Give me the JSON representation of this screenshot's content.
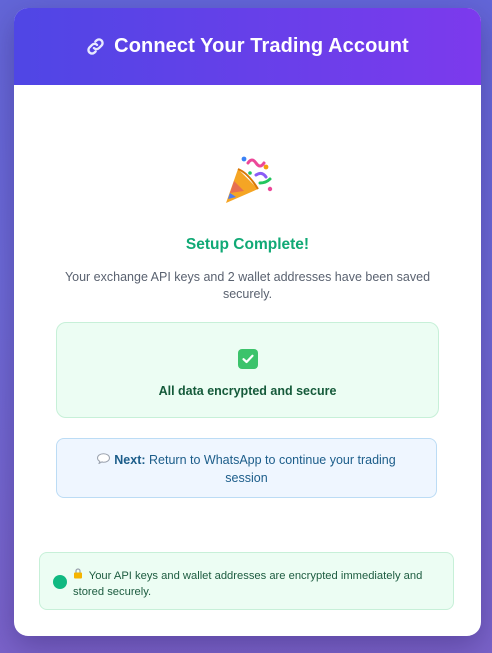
{
  "header": {
    "icon": "link-icon",
    "title": "Connect Your Trading Account"
  },
  "status": {
    "icon": "party-popper-icon",
    "title": "Setup Complete!",
    "description": "Your exchange API keys and 2 wallet addresses have been saved securely."
  },
  "secure_box": {
    "icon": "check-mark-icon",
    "text": "All data encrypted and secure"
  },
  "next_box": {
    "icon": "speech-bubble-icon",
    "label": "Next:",
    "text": "Return to WhatsApp to continue your trading session"
  },
  "footer": {
    "icon": "lock-icon",
    "text": "Your API keys and wallet addresses are encrypted immediately and stored securely."
  },
  "colors": {
    "header_gradient_start": "#4f46e5",
    "header_gradient_end": "#7c3aed",
    "success_green": "#10a975",
    "info_blue": "#1c5d8a"
  }
}
